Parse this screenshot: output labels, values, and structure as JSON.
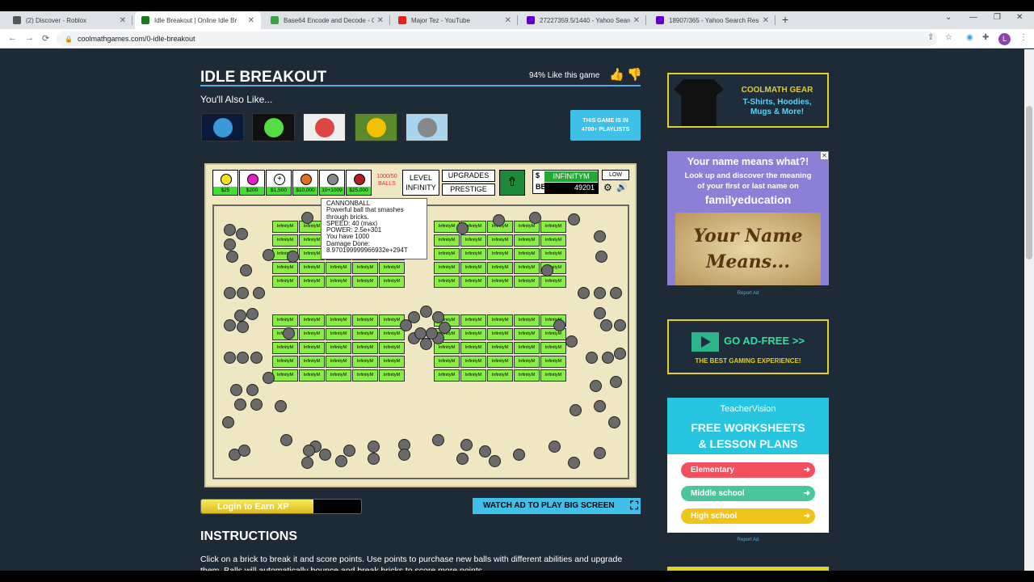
{
  "browser": {
    "tabs": [
      {
        "title": "(2) Discover - Roblox",
        "fav": "#555555"
      },
      {
        "title": "Idle Breakout | Online Idle Br",
        "fav": "#1a7a1a",
        "active": true
      },
      {
        "title": "Base64 Encode and Decode - Or",
        "fav": "#3da23d"
      },
      {
        "title": "Major Tez - YouTube",
        "fav": "#e62117"
      },
      {
        "title": "27227359.5/1440 - Yahoo Search",
        "fav": "#6001d2"
      },
      {
        "title": "18907/365 - Yahoo Search Result",
        "fav": "#6001d2"
      }
    ],
    "new_tab": "+",
    "url": "coolmathgames.com/0-idle-breakout",
    "profile_initial": "L",
    "icons": [
      "back-icon",
      "forward-icon",
      "reload-icon",
      "lock-icon",
      "share-icon",
      "star-icon",
      "extension-icon",
      "puzzle-icon",
      "menu-icon"
    ]
  },
  "page": {
    "title": "IDLE BREAKOUT",
    "like_text": "94% Like this game",
    "also_like": "You'll Also Like...",
    "playlist_badge": [
      "THIS GAME IS IN",
      "4700+ PLAYLISTS"
    ],
    "related_games": [
      {
        "name": "globe-game-thumbnail",
        "bg": "#0a1a3a",
        "fg": "#3a9ad9"
      },
      {
        "name": "green-slime-game-thumbnail",
        "bg": "#111111",
        "fg": "#55dd44"
      },
      {
        "name": "dice-game-thumbnail",
        "bg": "#eeeeee",
        "fg": "#dd4444"
      },
      {
        "name": "clicker-heroes-thumbnail",
        "bg": "#5a8a2a",
        "fg": "#f2c200"
      },
      {
        "name": "cannon-game-thumbnail",
        "bg": "#aad4ee",
        "fg": "#888888"
      }
    ],
    "xp_label": "Login to Earn XP",
    "xp_progress": 0.7,
    "bigscreen_label": "WATCH AD TO PLAY BIG SCREEN",
    "instructions_heading": "INSTRUCTIONS",
    "instructions_text": "Click on a brick to break it and score points. Use points to purchase new balls with different abilities and upgrade them. Balls will automatically bounce and break bricks to score more points."
  },
  "game": {
    "balls": [
      {
        "price": "$25",
        "color": "#f5e11d"
      },
      {
        "price": "$200",
        "color": "#e020c0"
      },
      {
        "price": "$1,500",
        "color": "#ffffff",
        "glyph": "+"
      },
      {
        "price": "$10,000",
        "color": "#e07020"
      },
      {
        "price": "10+1009",
        "color": "#888888"
      },
      {
        "price": "$25,000",
        "color": "#b02020"
      }
    ],
    "ball_count": "1000/50\nBALLS",
    "level_label": "LEVEL\nINFINITY",
    "upgrades_label": "UPGRADES",
    "prestige_label": "PRESTIGE",
    "money_symbol": "$",
    "money_value": "INFINITYM",
    "bb_symbol": "BB",
    "bb_value": "49201",
    "low_label": "LOW",
    "brick_label": "InfinityM",
    "tooltip": [
      "CANNONBALL",
      "Powerful ball that smashes",
      "through bricks.",
      "SPEED: 40 (max)",
      "POWER: 2.5e+301",
      "You have 1000",
      "Damage Done:",
      "8.970199999966932e+294T"
    ]
  },
  "ads": {
    "gear": {
      "title": "COOLMATH GEAR",
      "line": "T-Shirts, Hoodies,",
      "line2": "Mugs & More!"
    },
    "familyed": {
      "title": "Your name means what?!",
      "sub1": "Look up and discover the meaning",
      "sub2": "of your first or last name on",
      "brand": "familyeducation",
      "script1": "Your Name",
      "script2": "Means..."
    },
    "report_label": "Report Ad",
    "adfree": {
      "title": "GO AD-FREE >>",
      "sub": "THE BEST GAMING EXPERIENCE!"
    },
    "teacher": {
      "brand": "TeacherVision",
      "title1": "FREE WORKSHEETS",
      "title2": "& LESSON PLANS",
      "buttons": [
        "Elementary",
        "Middle school",
        "High school"
      ]
    }
  }
}
